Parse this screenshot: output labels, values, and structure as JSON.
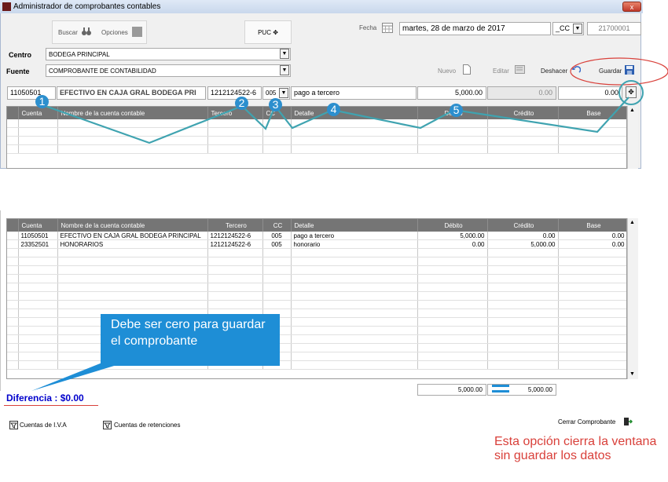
{
  "window": {
    "title": "Administrador de comprobantes contables",
    "close_label": "x"
  },
  "toolbar": {
    "search_label": "Buscar",
    "options_label": "Opciones",
    "puc_label": "PUC ✥"
  },
  "fecha": {
    "label": "Fecha",
    "value": "martes, 28 de marzo de 2017",
    "cc_value": "_CC",
    "number": "21700001"
  },
  "centro": {
    "label": "Centro",
    "value": "BODEGA PRINCIPAL"
  },
  "fuente": {
    "label": "Fuente",
    "value": "COMPROBANTE DE CONTABILIDAD"
  },
  "actions": {
    "nuevo": "Nuevo",
    "editar": "Editar",
    "deshacer": "Deshacer",
    "guardar": "Guardar"
  },
  "entry": {
    "cuenta": "11050501",
    "nombre": "EFECTIVO EN CAJA GRAL BODEGA PRI",
    "tercero": "1212124522-6",
    "cc": "005",
    "detalle": "pago a tercero",
    "debito": "5,000.00",
    "credito": "0.00",
    "base": "0.00",
    "add_label": "✥"
  },
  "columns": [
    "Cuenta",
    "Nombre de la cuenta contable",
    "Tercero",
    "CC",
    "Detalle",
    "Débito",
    "Crédito",
    "Base"
  ],
  "rows": [
    {
      "cuenta": "11050501",
      "nombre": "EFECTIVO EN CAJA GRAL BODEGA PRINCIPAL",
      "tercero": "1212124522-6",
      "cc": "005",
      "detalle": "pago a tercero",
      "debito": "5,000.00",
      "credito": "0.00",
      "base": "0.00"
    },
    {
      "cuenta": "23352501",
      "nombre": "HONORARIOS",
      "tercero": "1212124522-6",
      "cc": "005",
      "detalle": "honorario",
      "debito": "0.00",
      "credito": "5,000.00",
      "base": "0.00"
    }
  ],
  "totals": {
    "debito": "5,000.00",
    "credito": "5,000.00"
  },
  "diferencia": "Diferencia : $0.00",
  "callout": "Debe ser cero para guardar el comprobante",
  "markers": [
    "1",
    "2",
    "3",
    "4",
    "5"
  ],
  "footer": {
    "iva": "Cuentas de I.V.A",
    "retenciones": "Cuentas de retenciones",
    "cerrar": "Cerrar Comprobante"
  },
  "note": "Esta opción cierra la ventana sin guardar los datos",
  "colors": {
    "annotation": "#2c8fce",
    "oval": "#d9403a",
    "note": "#d9403a",
    "diferencia": "#0000cc"
  }
}
